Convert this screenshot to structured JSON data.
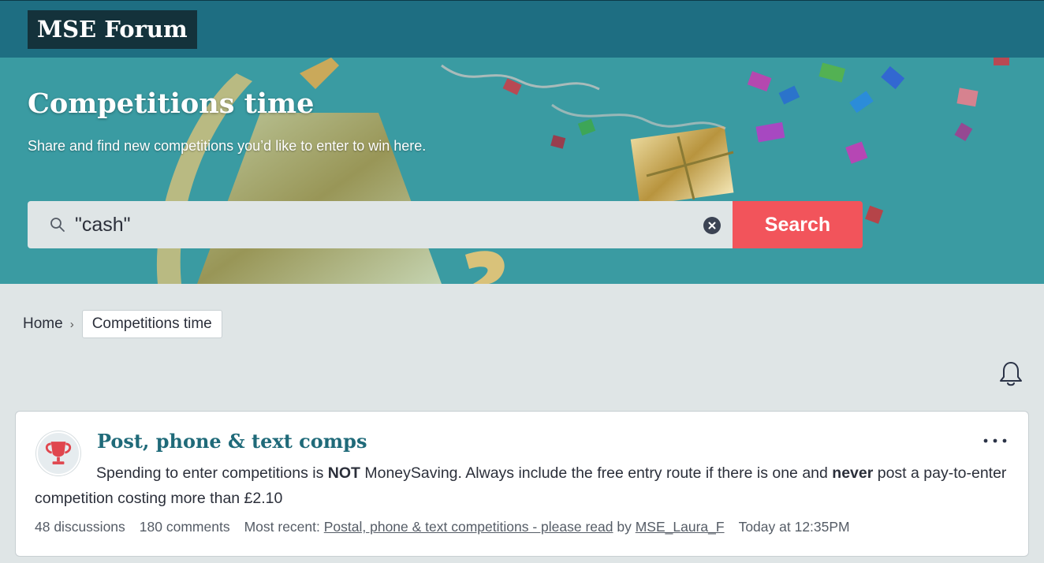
{
  "header": {
    "logo": "MSE Forum"
  },
  "hero": {
    "title": "Competitions time",
    "subtitle": "Share and find new competitions you’d like to enter to win here."
  },
  "search": {
    "value": "\"cash\"",
    "button_label": "Search",
    "icon": "search-icon",
    "clear_icon": "clear-icon"
  },
  "breadcrumb": {
    "home": "Home",
    "separator": "›",
    "current": "Competitions time"
  },
  "notifications": {
    "icon": "bell-icon"
  },
  "category": {
    "title": "Post, phone & text comps",
    "icon": "trophy-icon",
    "description_parts": {
      "p1": "Spending to enter competitions is ",
      "b1": "NOT",
      "p2": " MoneySaving. Always include the free entry route if there is one and ",
      "b2": "never",
      "p3": " post a pay-to-enter competition costing more than £2.10"
    },
    "discussions": "48 discussions",
    "comments": "180 comments",
    "most_recent_label": "Most recent:",
    "most_recent_title": "Postal, phone & text competitions - please read",
    "by_label": "by",
    "author": "MSE_Laura_F",
    "timestamp": "Today at 12:35PM"
  },
  "colors": {
    "topbar": "#1e6e82",
    "logo_bg": "#14323b",
    "search_button": "#f2545b",
    "title_accent": "#1f6a79",
    "page_bg": "#dfe5e6"
  }
}
